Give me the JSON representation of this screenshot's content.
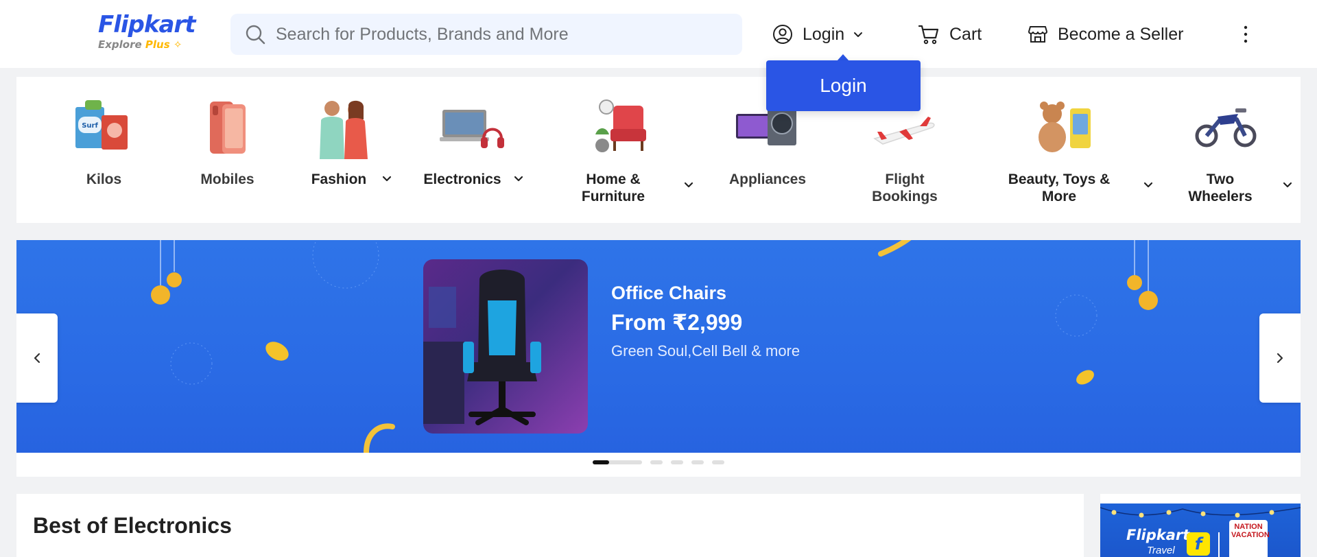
{
  "header": {
    "logo": {
      "name": "Flipkart",
      "tagline": "Explore",
      "tagline_plus": "Plus"
    },
    "search": {
      "placeholder": "Search for Products, Brands and More"
    },
    "nav": {
      "login_label": "Login",
      "cart_label": "Cart",
      "seller_label": "Become a Seller"
    },
    "login_dropdown": {
      "label": "Login"
    }
  },
  "categories": [
    {
      "label": "Kilos",
      "has_menu": false
    },
    {
      "label": "Mobiles",
      "has_menu": false
    },
    {
      "label": "Fashion",
      "has_menu": true
    },
    {
      "label": "Electronics",
      "has_menu": true
    },
    {
      "label_line1": "Home &",
      "label_line2": "Furniture",
      "has_menu": true
    },
    {
      "label": "Appliances",
      "has_menu": false
    },
    {
      "label_line1": "Flight",
      "label_line2": "Bookings",
      "has_menu": false
    },
    {
      "label_line1": "Beauty, Toys &",
      "label_line2": "More",
      "has_menu": true
    },
    {
      "label_line1": "Two",
      "label_line2": "Wheelers",
      "has_menu": true
    }
  ],
  "banner": {
    "title": "Office Chairs",
    "price": "From ₹2,999",
    "subtitle": "Green Soul,Cell Bell & more",
    "slide_count": 6,
    "active_slide": 1
  },
  "sections": {
    "best_of_electronics": {
      "title": "Best of Electronics"
    }
  },
  "side_ad": {
    "brand": "Flipkart",
    "brand_sub": "Travel",
    "badge_line1": "NATION",
    "badge_line2": "VACATION"
  },
  "colors": {
    "brand_blue": "#2a55e5",
    "banner_blue": "#2a6be5",
    "search_bg": "#f0f5ff",
    "page_bg": "#f1f2f4"
  }
}
